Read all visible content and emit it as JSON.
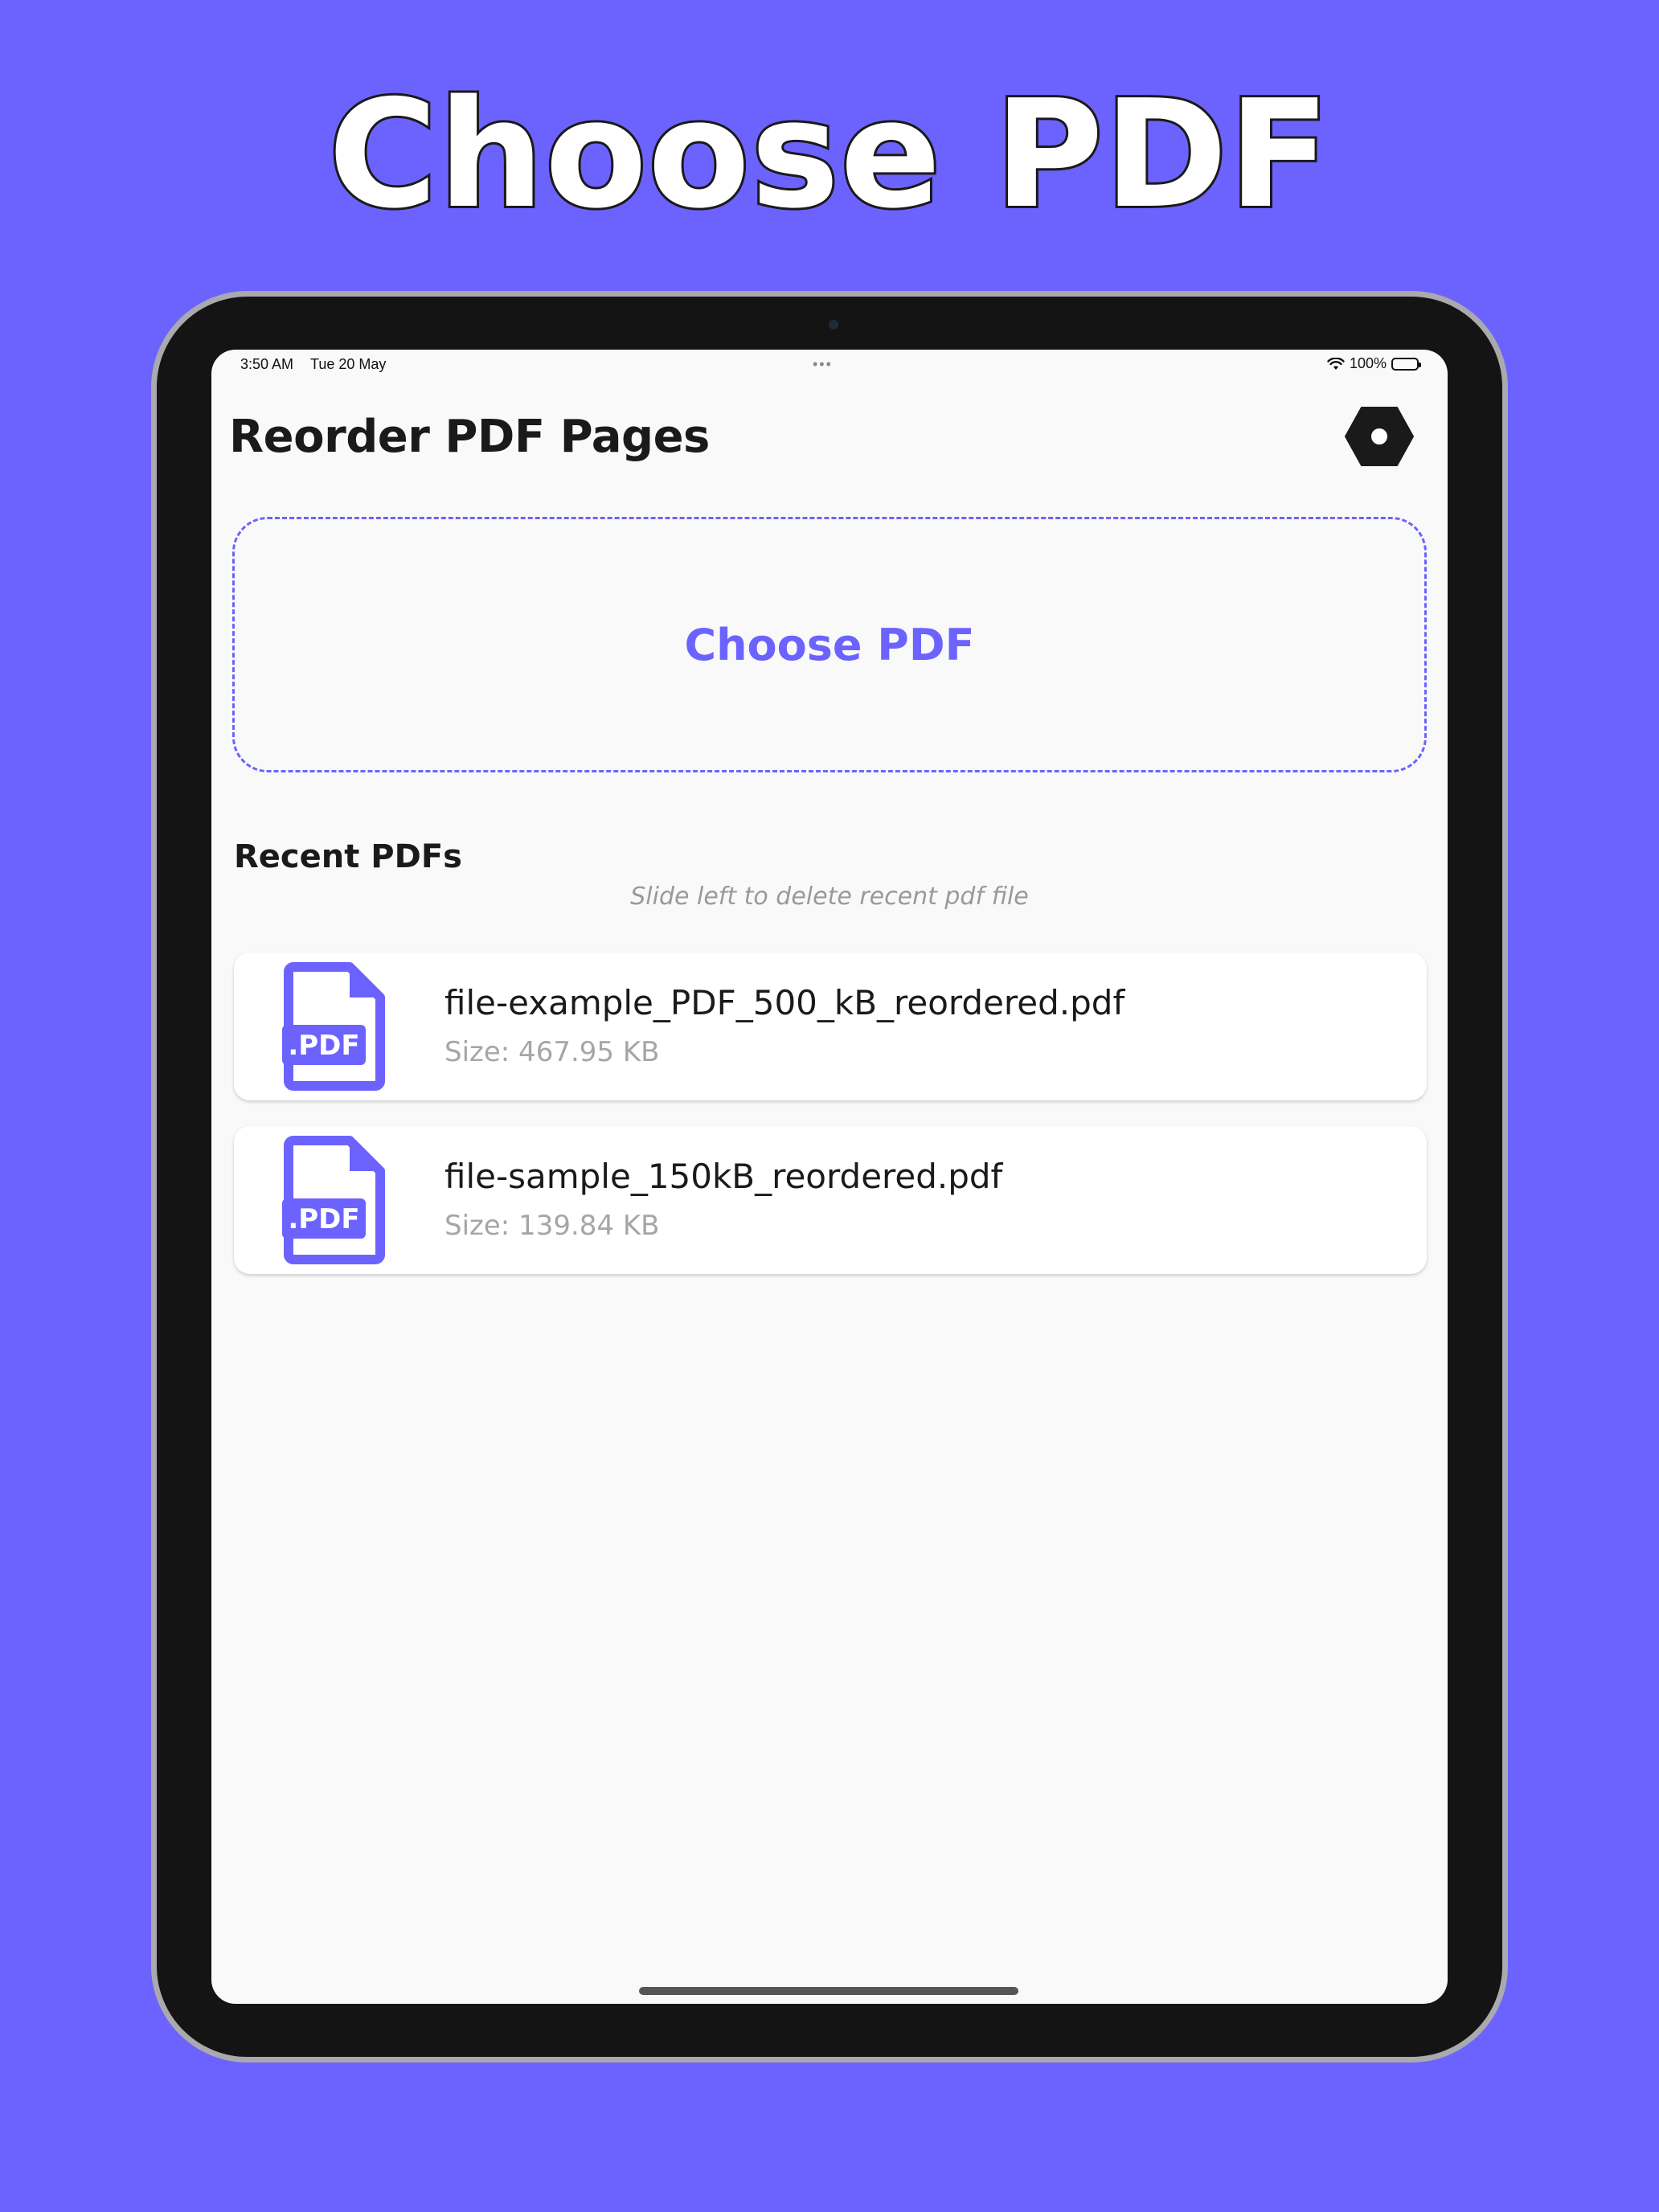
{
  "promo": {
    "title": "Choose PDF"
  },
  "status_bar": {
    "time": "3:50 AM",
    "date": "Tue 20 May",
    "dots": "•••",
    "battery": "100%"
  },
  "header": {
    "title": "Reorder PDF Pages",
    "settings_icon": "gear-icon"
  },
  "picker": {
    "label": "Choose PDF"
  },
  "recent": {
    "heading": "Recent PDFs",
    "hint": "Slide left to delete recent pdf file",
    "files": [
      {
        "name": "file-example_PDF_500_kB_reordered.pdf",
        "size": "Size: 467.95 KB",
        "icon_label": ".PDF"
      },
      {
        "name": "file-sample_150kB_reordered.pdf",
        "size": "Size: 139.84 KB",
        "icon_label": ".PDF"
      }
    ]
  },
  "colors": {
    "brand": "#6c63ff",
    "background": "#f9f9f9",
    "text": "#1a1a1a",
    "muted": "#a6a6a6"
  }
}
